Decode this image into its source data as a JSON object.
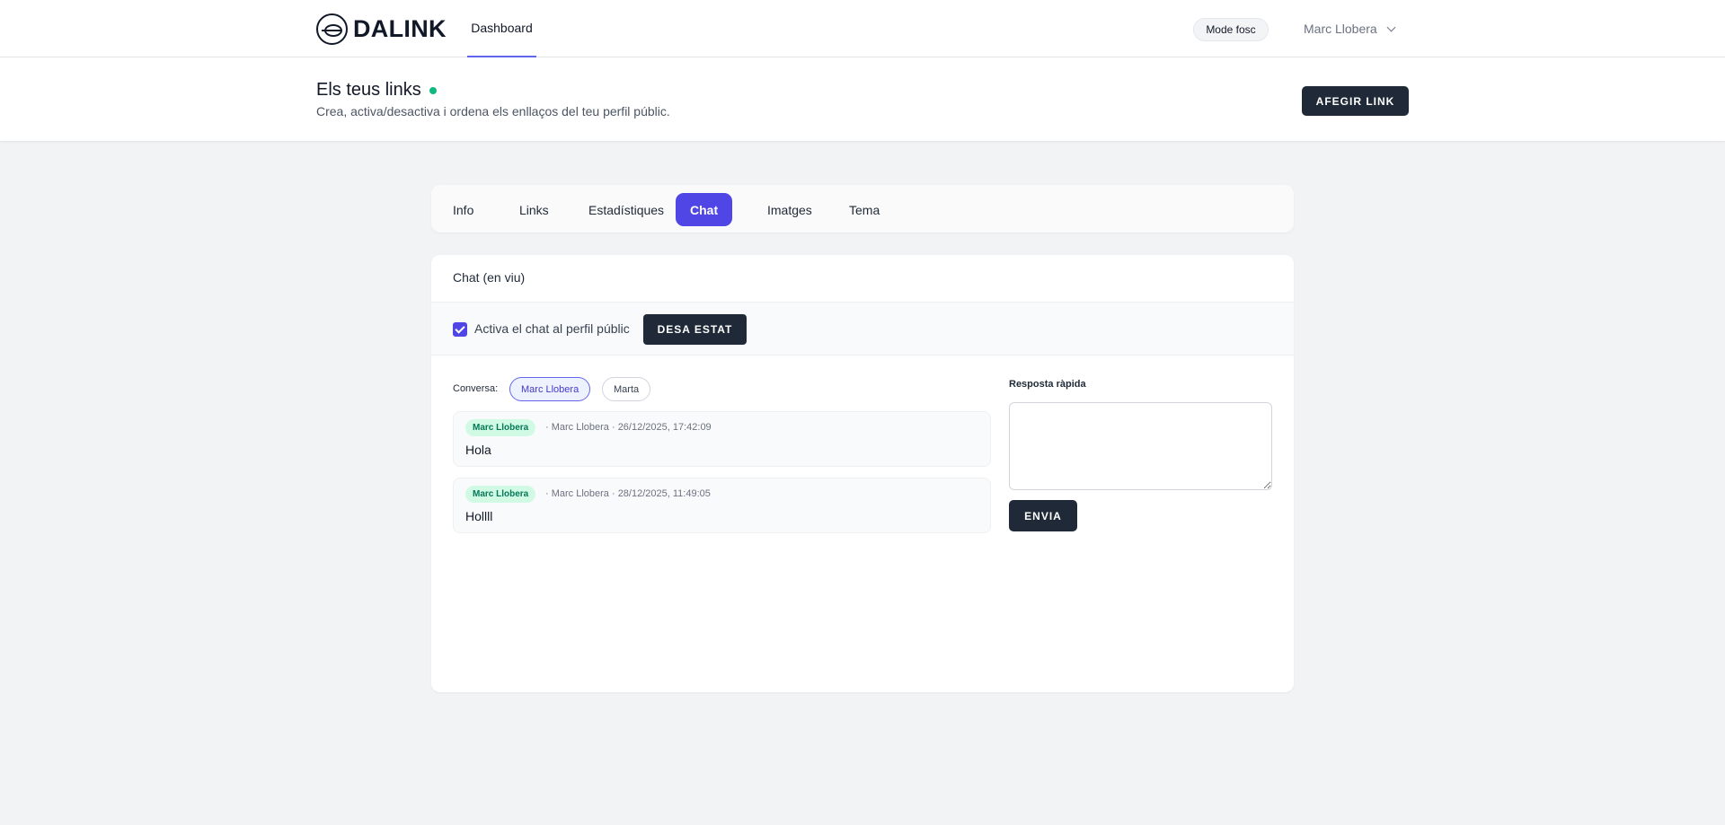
{
  "nav": {
    "logo_text": "DALINK",
    "dashboard_label": "Dashboard",
    "dark_mode_label": "Mode fosc",
    "user_name": "Marc Llobera"
  },
  "header": {
    "title": "Els teus links",
    "subtitle": "Crea, activa/desactiva i ordena els enllaços del teu perfil públic.",
    "add_link_label": "AFEGIR LINK"
  },
  "tabs": [
    {
      "label": "Info",
      "active": false
    },
    {
      "label": "Links",
      "active": false
    },
    {
      "label": "Estadístiques",
      "active": false
    },
    {
      "label": "Chat",
      "active": true
    },
    {
      "label": "Imatges",
      "active": false
    },
    {
      "label": "Tema",
      "active": false
    }
  ],
  "chat": {
    "title": "Chat (en viu)",
    "enable_label": "Activa el chat al perfil públic",
    "enabled": true,
    "save_state_label": "DESA ESTAT",
    "conversation_label": "Conversa:",
    "conversations": [
      {
        "name": "Marc Llobera",
        "active": true
      },
      {
        "name": "Marta",
        "active": false
      }
    ],
    "messages": [
      {
        "badge": "Marc Llobera",
        "meta": "· Marc Llobera   · 26/12/2025, 17:42:09",
        "text": "Hola"
      },
      {
        "badge": "Marc Llobera",
        "meta": "· Marc Llobera   · 28/12/2025, 11:49:05",
        "text": "Hollll"
      }
    ],
    "quick_reply_label": "Resposta ràpida",
    "quick_reply_value": "",
    "send_label": "ENVIA"
  },
  "colors": {
    "accent": "#4f46e5",
    "dark_button": "#1f2937",
    "status_online": "#10b981",
    "badge_bg": "#d1fae5",
    "badge_text": "#047857"
  }
}
